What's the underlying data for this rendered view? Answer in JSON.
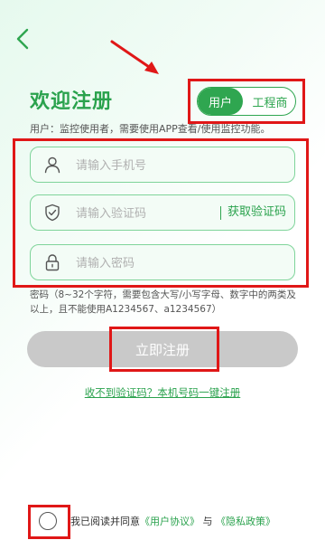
{
  "header": {
    "back_icon": "chevron-left-icon",
    "title": "欢迎注册",
    "description": "用户：监控使用者，需要使用APP查看/使用监控功能。"
  },
  "role_toggle": {
    "options": [
      "用户",
      "工程商"
    ],
    "selected": "用户"
  },
  "form": {
    "phone_placeholder": "请输入手机号",
    "code_placeholder": "请输入验证码",
    "get_code_label": "获取验证码",
    "password_placeholder": "请输入密码",
    "password_hint": "密码（8~32个字符，需要包含大写/小写字母、数字中的两类及以上，且不能使用A1234567、a1234567）"
  },
  "actions": {
    "register_label": "立即注册",
    "one_key_label": "收不到验证码？本机号码一键注册"
  },
  "agreement": {
    "prefix": "我已阅读并同意",
    "user_agreement": "《用户协议》",
    "and": "与",
    "privacy_policy": "《隐私政策》"
  },
  "colors": {
    "brand_green": "#2fa650",
    "annotation_red": "#e01717",
    "disabled_button": "#c9c9c9"
  }
}
